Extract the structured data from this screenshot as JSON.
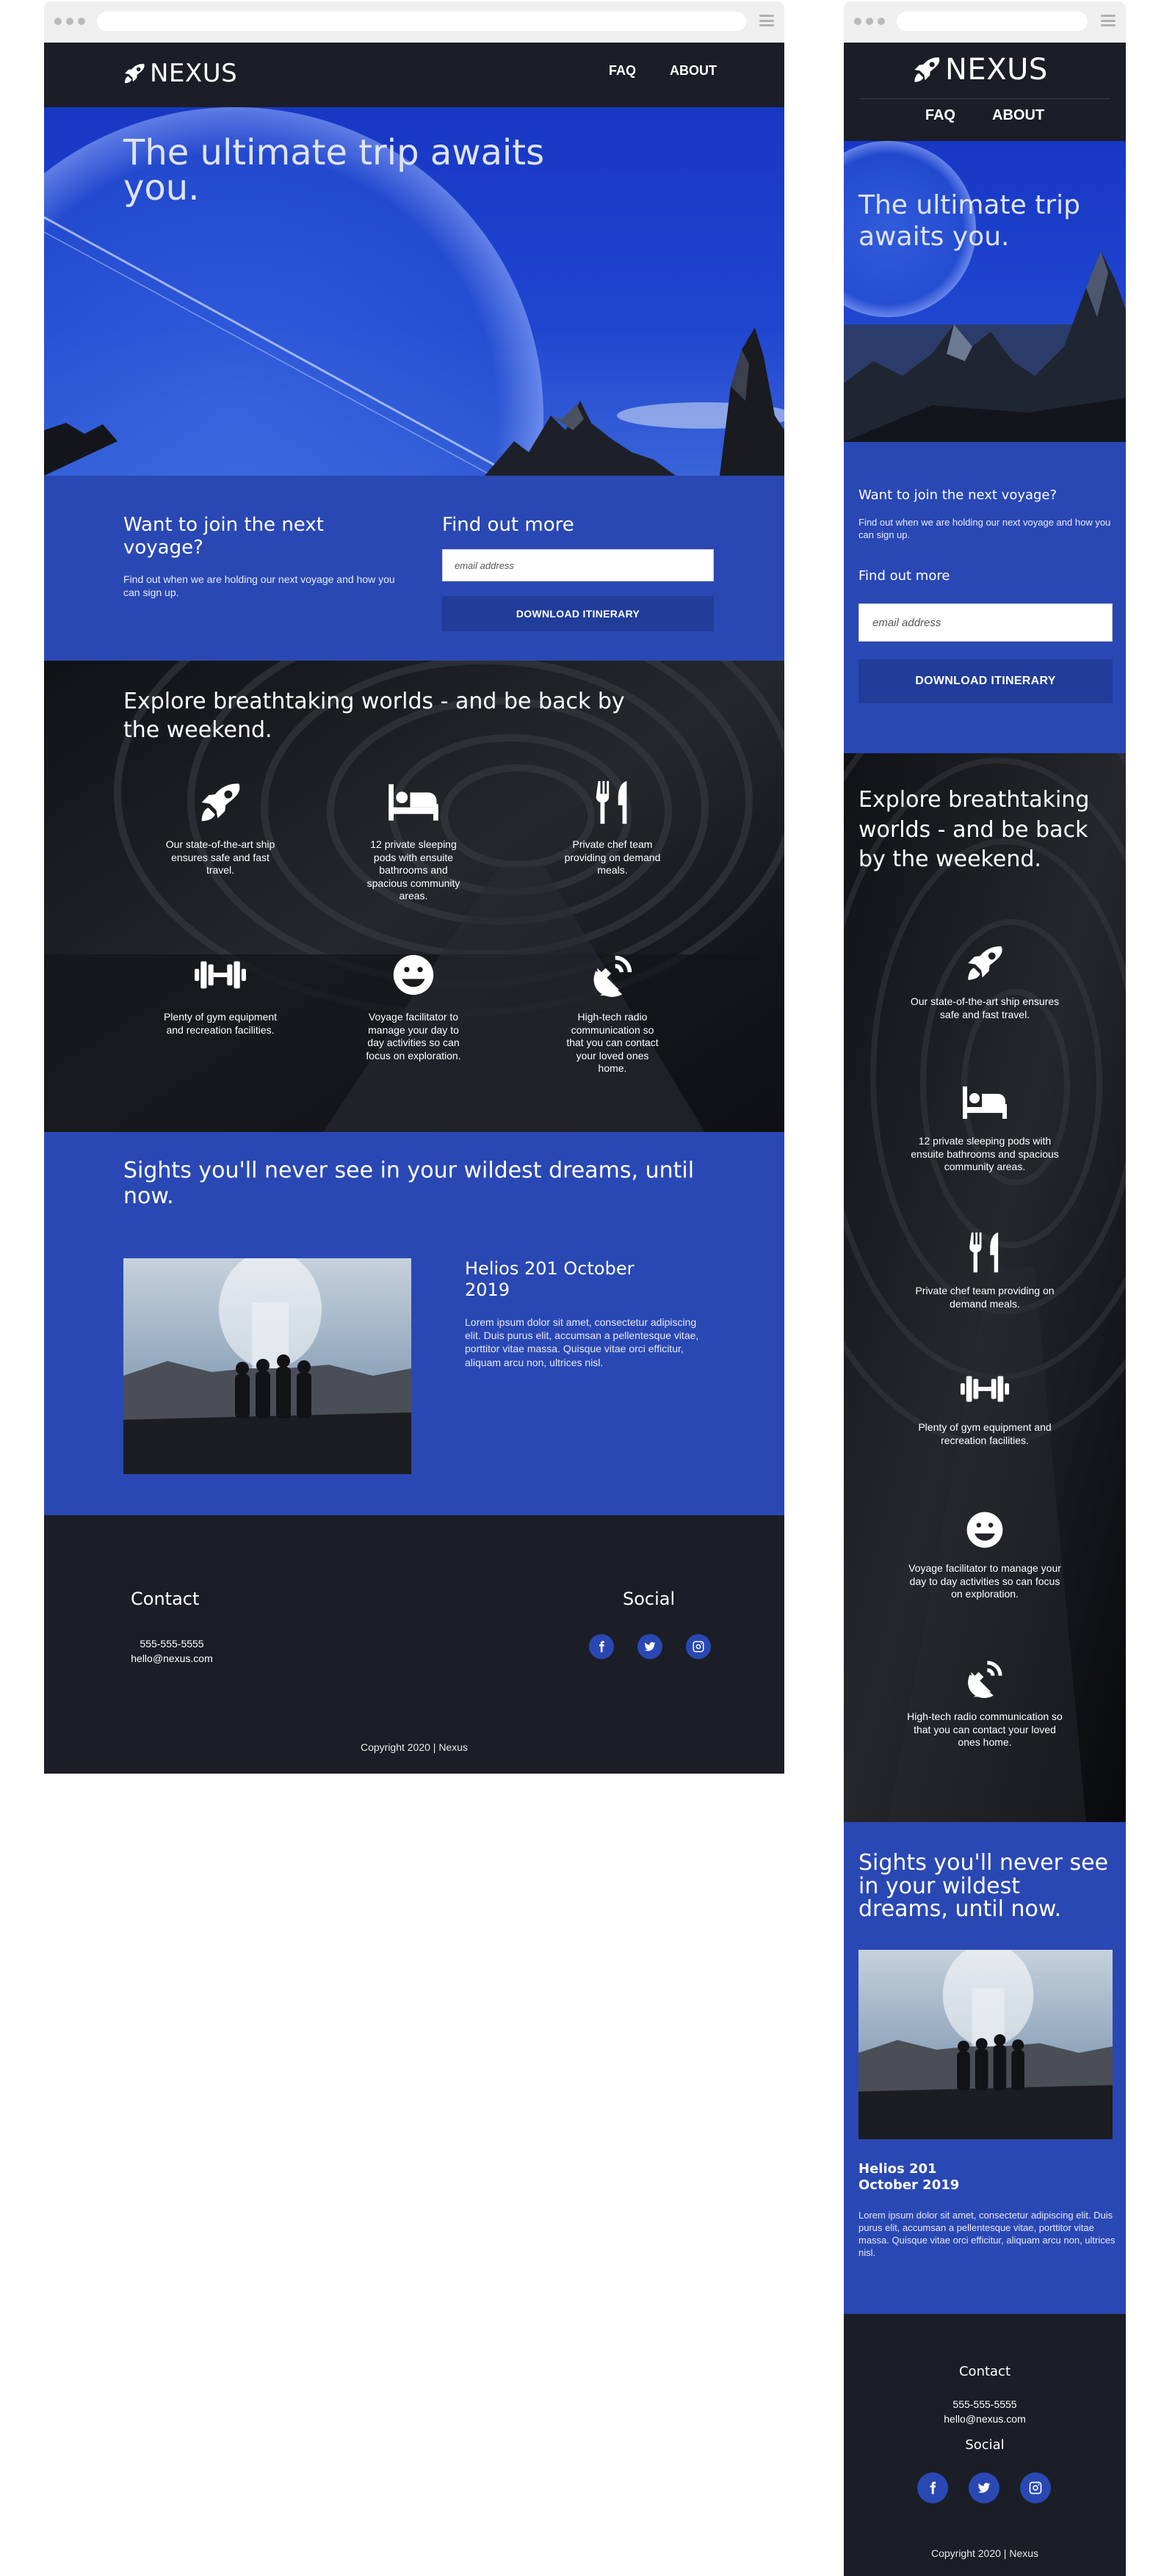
{
  "brand": {
    "name": "NEXUS",
    "logo_icon": "rocket-icon"
  },
  "nav": [
    {
      "label": "FAQ"
    },
    {
      "label": "ABOUT"
    }
  ],
  "hero": {
    "title": "The ultimate trip awaits you."
  },
  "signup": {
    "join_title": "Want to join the next voyage?",
    "join_text": "Find out when we are holding our next voyage and how you can sign up.",
    "find_title": "Find out more",
    "email_placeholder": "email address",
    "button_label": "DOWNLOAD ITINERARY"
  },
  "features": {
    "title": "Explore breathtaking worlds - and be back by the weekend.",
    "items": [
      {
        "icon": "rocket-icon",
        "text": "Our state-of-the-art ship ensures safe and fast travel."
      },
      {
        "icon": "bed-icon",
        "text": "12 private sleeping pods with ensuite bathrooms and spacious community areas."
      },
      {
        "icon": "utensils-icon",
        "text": "Private chef team providing on demand meals."
      },
      {
        "icon": "dumbbell-icon",
        "text": "Plenty of gym equipment and recreation facilities."
      },
      {
        "icon": "smile-icon",
        "text": "Voyage facilitator to manage your day to day activities so can focus on exploration."
      },
      {
        "icon": "satellite-dish-icon",
        "text": "High-tech radio communication so that you can contact your loved ones home."
      }
    ]
  },
  "sights": {
    "title": "Sights you'll never see in your wildest dreams, until now.",
    "event_title": "Helios 201 October 2019",
    "event_body": "Lorem ipsum dolor sit amet, consectetur adipiscing elit. Duis purus elit, accumsan a pellentesque vitae, porttitor vitae massa. Quisque vitae orci efficitur, aliquam arcu non, ultrices nisl."
  },
  "footer": {
    "contact_title": "Contact",
    "phone": "555-555-5555",
    "email": "hello@nexus.com",
    "social_title": "Social",
    "social": [
      {
        "icon": "facebook-icon"
      },
      {
        "icon": "twitter-icon"
      },
      {
        "icon": "instagram-icon"
      }
    ],
    "copyright": "Copyright 2020 | Nexus"
  },
  "colors": {
    "brand_blue": "#2a48b4",
    "dark": "#1b1e26",
    "button_blue": "#213c99"
  }
}
